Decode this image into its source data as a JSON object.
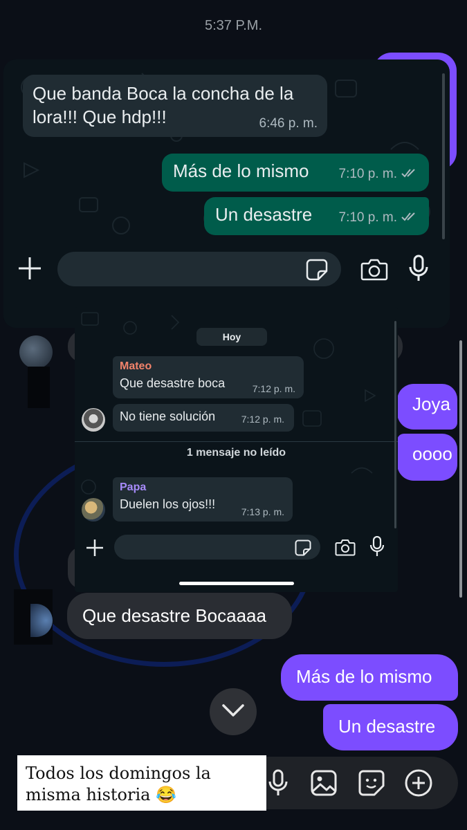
{
  "status_time": "5:37 P.M.",
  "messenger": {
    "messages_out": [
      "Joya",
      "oooo",
      "Más de lo mismo",
      "Un desastre"
    ],
    "message_in": "Que desastre Bocaaaa"
  },
  "screenshot1": {
    "incoming": {
      "text": "Que banda Boca la concha de la lora!!! Que hdp!!!",
      "time": "6:46 p. m."
    },
    "outgoing": [
      {
        "text": "Más de lo mismo",
        "time": "7:10 p. m."
      },
      {
        "text": "Un desastre",
        "time": "7:10 p. m."
      }
    ]
  },
  "screenshot2": {
    "day_chip": "Hoy",
    "group1": {
      "sender": "Mateo",
      "sender_color": "#f2836b",
      "messages": [
        {
          "text": "Que desastre boca",
          "time": "7:12 p. m."
        },
        {
          "text": "No tiene solución",
          "time": "7:12 p. m."
        }
      ]
    },
    "unread_divider": "1 mensaje no leído",
    "group2": {
      "sender": "Papa",
      "sender_color": "#a78bfa",
      "messages": [
        {
          "text": "Duelen los ojos!!!",
          "time": "7:13 p. m."
        }
      ]
    }
  },
  "caption": "Todos los domingos la misma historia 😂",
  "colors": {
    "messenger_accent": "#7c4dff",
    "wa_outgoing": "#005c4b",
    "wa_incoming": "#202c33",
    "background": "#0b0f17"
  },
  "icons": [
    "plus-icon",
    "sticker-icon",
    "camera-icon",
    "microphone-icon",
    "image-icon",
    "chevron-down-icon",
    "double-check-icon"
  ]
}
